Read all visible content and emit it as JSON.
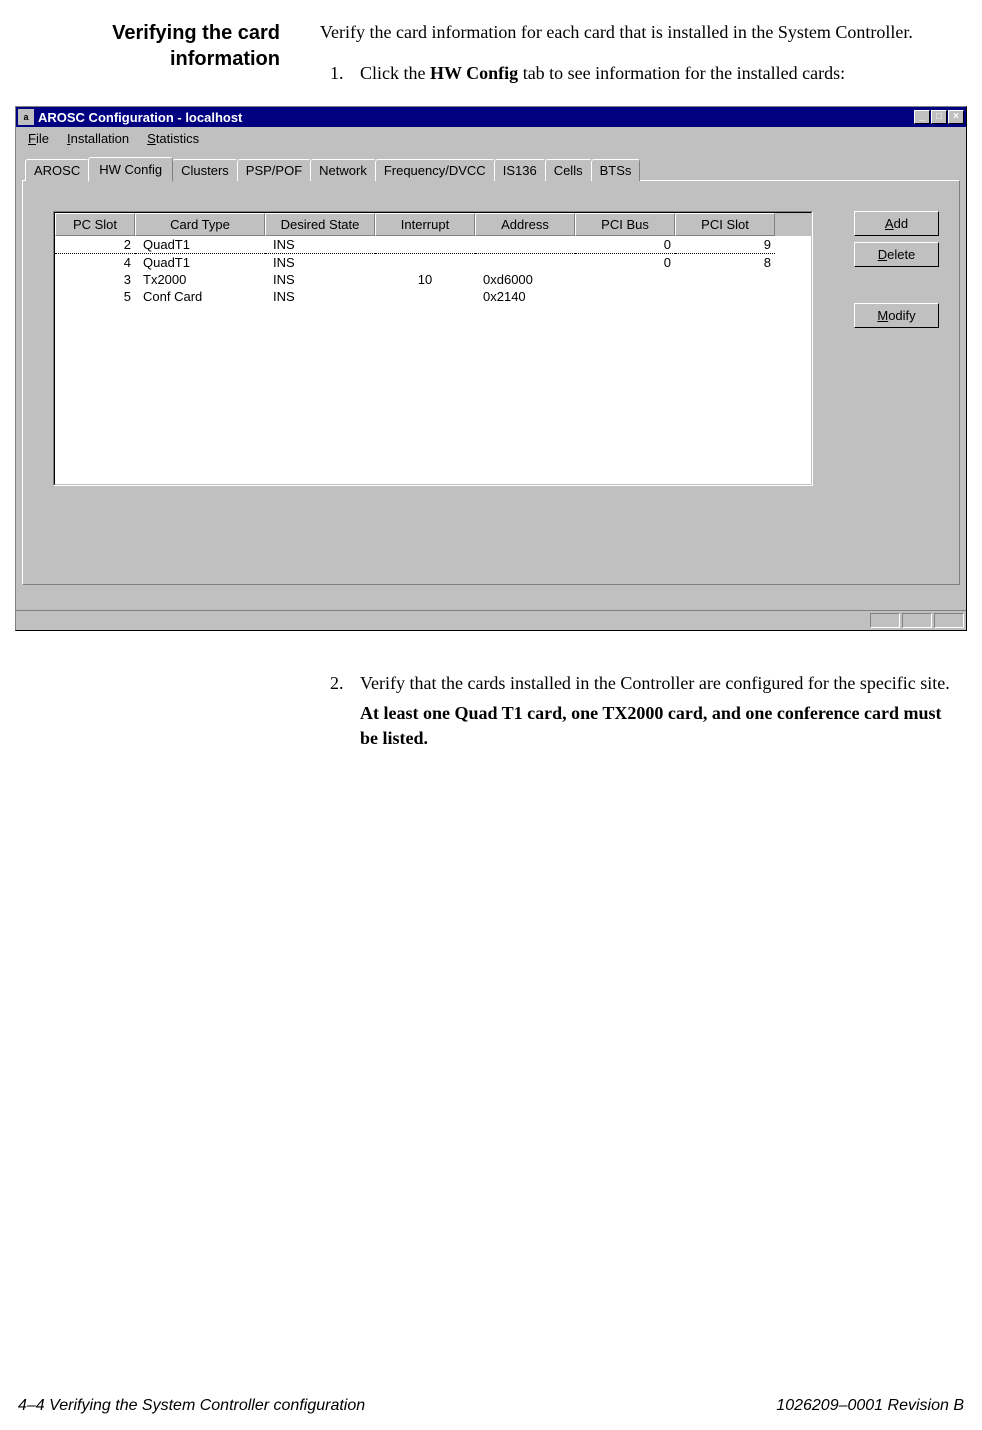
{
  "doc": {
    "section_title_line1": "Verifying the card",
    "section_title_line2": "information",
    "intro": "Verify the card information for each card that is installed in the System Controller.",
    "step1_num": "1.",
    "step1_pre": "Click the ",
    "step1_bold": "HW Config",
    "step1_post": " tab to see information for the installed cards:",
    "step2_num": "2.",
    "step2_text": "Verify that the cards installed in the Controller are configured for the specific site.",
    "step2_bold": "At least one Quad T1 card, one TX2000 card, and one conference card must be listed."
  },
  "window": {
    "title": "AROSC Configuration - localhost",
    "icon_char": "a",
    "minimize": "_",
    "maximize": "□",
    "close": "×",
    "menu": {
      "file": "File",
      "file_u": "F",
      "installation": "Installation",
      "installation_u": "I",
      "statistics": "Statistics",
      "statistics_u": "S"
    },
    "tabs": [
      "AROSC",
      "HW Config",
      "Clusters",
      "PSP/POF",
      "Network",
      "Frequency/DVCC",
      "IS136",
      "Cells",
      "BTSs"
    ],
    "active_tab": "HW Config",
    "columns": [
      "PC Slot",
      "Card Type",
      "Desired State",
      "Interrupt",
      "Address",
      "PCI Bus",
      "PCI Slot"
    ],
    "rows": [
      {
        "pcslot": "2",
        "cardtype": "QuadT1",
        "desired": "INS",
        "interrupt": "",
        "address": "",
        "pcibus": "0",
        "pcislot": "9"
      },
      {
        "pcslot": "4",
        "cardtype": "QuadT1",
        "desired": "INS",
        "interrupt": "",
        "address": "",
        "pcibus": "0",
        "pcislot": "8"
      },
      {
        "pcslot": "3",
        "cardtype": "Tx2000",
        "desired": "INS",
        "interrupt": "10",
        "address": "0xd6000",
        "pcibus": "",
        "pcislot": ""
      },
      {
        "pcslot": "5",
        "cardtype": "Conf Card",
        "desired": "INS",
        "interrupt": "",
        "address": "0x2140",
        "pcibus": "",
        "pcislot": ""
      }
    ],
    "buttons": {
      "add": "Add",
      "add_u": "A",
      "delete": "Delete",
      "delete_u": "D",
      "modify": "Modify",
      "modify_u": "M"
    }
  },
  "footer": {
    "left": "4–4  Verifying the System Controller configuration",
    "right": "1026209–0001  Revision B"
  }
}
